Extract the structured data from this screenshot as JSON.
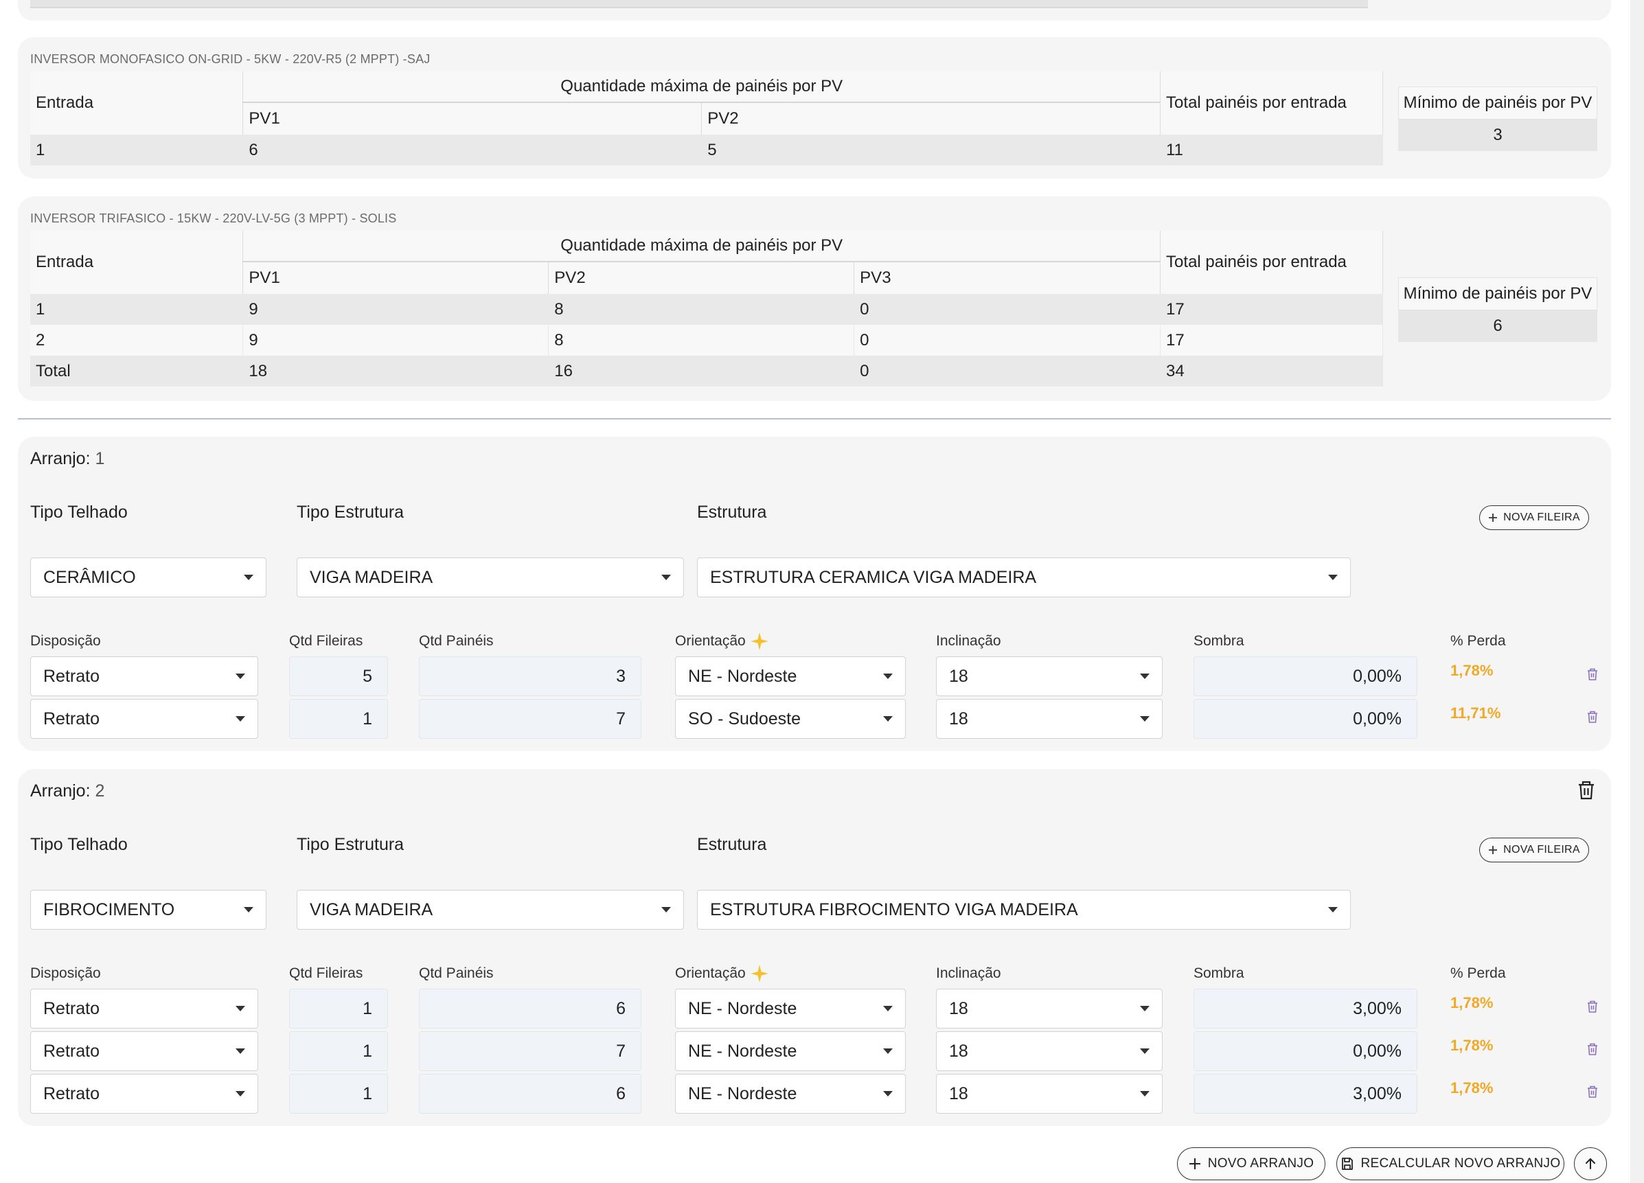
{
  "inverters": [
    {
      "title": "INVERSOR MONOFASICO ON-GRID - 5KW - 220V-R5 (2 MPPT) -SAJ",
      "col_entrada": "Entrada",
      "col_group": "Quantidade máxima de painéis por PV",
      "col_total": "Total painéis por entrada",
      "pv_headers": [
        "PV1",
        "PV2"
      ],
      "rows": [
        {
          "entrada": "1",
          "pv": [
            "6",
            "5"
          ],
          "total": "11"
        }
      ],
      "min_label": "Mínimo de painéis por PV",
      "min_value": "3"
    },
    {
      "title": "INVERSOR TRIFASICO - 15KW - 220V-LV-5G (3 MPPT) - SOLIS",
      "col_entrada": "Entrada",
      "col_group": "Quantidade máxima de painéis por PV",
      "col_total": "Total painéis por entrada",
      "pv_headers": [
        "PV1",
        "PV2",
        "PV3"
      ],
      "rows": [
        {
          "entrada": "1",
          "pv": [
            "9",
            "8",
            "0"
          ],
          "total": "17"
        },
        {
          "entrada": "2",
          "pv": [
            "9",
            "8",
            "0"
          ],
          "total": "17"
        },
        {
          "entrada": "Total",
          "pv": [
            "18",
            "16",
            "0"
          ],
          "total": "34"
        }
      ],
      "min_label": "Mínimo de painéis por PV",
      "min_value": "6"
    }
  ],
  "labels": {
    "arranjo": "Arranjo:",
    "tipo_telhado": "Tipo Telhado",
    "tipo_estrutura": "Tipo Estrutura",
    "estrutura": "Estrutura",
    "nova_fileira": "NOVA FILEIRA",
    "disposicao": "Disposição",
    "qtd_fileiras": "Qtd Fileiras",
    "qtd_paineis": "Qtd Painéis",
    "orientacao": "Orientação",
    "inclinacao": "Inclinação",
    "sombra": "Sombra",
    "perda": "% Perda"
  },
  "arranjos": [
    {
      "number": "1",
      "tipo_telhado": "CERÂMICO",
      "tipo_estrutura": "VIGA MADEIRA",
      "estrutura": "ESTRUTURA CERAMICA VIGA MADEIRA",
      "rows": [
        {
          "disposicao": "Retrato",
          "fileiras": "5",
          "paineis": "3",
          "orientacao": "NE - Nordeste",
          "inclinacao": "18",
          "sombra": "0,00%",
          "perda": "1,78%"
        },
        {
          "disposicao": "Retrato",
          "fileiras": "1",
          "paineis": "7",
          "orientacao": "SO - Sudoeste",
          "inclinacao": "18",
          "sombra": "0,00%",
          "perda": "11,71%"
        }
      ]
    },
    {
      "number": "2",
      "tipo_telhado": "FIBROCIMENTO",
      "tipo_estrutura": "VIGA MADEIRA",
      "estrutura": "ESTRUTURA FIBROCIMENTO VIGA MADEIRA",
      "rows": [
        {
          "disposicao": "Retrato",
          "fileiras": "1",
          "paineis": "6",
          "orientacao": "NE - Nordeste",
          "inclinacao": "18",
          "sombra": "3,00%",
          "perda": "1,78%"
        },
        {
          "disposicao": "Retrato",
          "fileiras": "1",
          "paineis": "7",
          "orientacao": "NE - Nordeste",
          "inclinacao": "18",
          "sombra": "0,00%",
          "perda": "1,78%"
        },
        {
          "disposicao": "Retrato",
          "fileiras": "1",
          "paineis": "6",
          "orientacao": "NE - Nordeste",
          "inclinacao": "18",
          "sombra": "3,00%",
          "perda": "1,78%"
        }
      ]
    }
  ],
  "footer": {
    "novo_arranjo": "NOVO ARRANJO",
    "recalcular": "RECALCULAR NOVO ARRANJO"
  },
  "icons": {
    "sparkle": "sparkle-icon",
    "trash": "trash-icon",
    "plus": "plus-icon",
    "save": "save-icon",
    "arrow_up": "arrow-up-icon",
    "caret": "chevron-down-icon"
  },
  "colors": {
    "perda": "#f0a825",
    "sparkle": "#f6c02a",
    "trash_small": "#8b6fbe"
  }
}
